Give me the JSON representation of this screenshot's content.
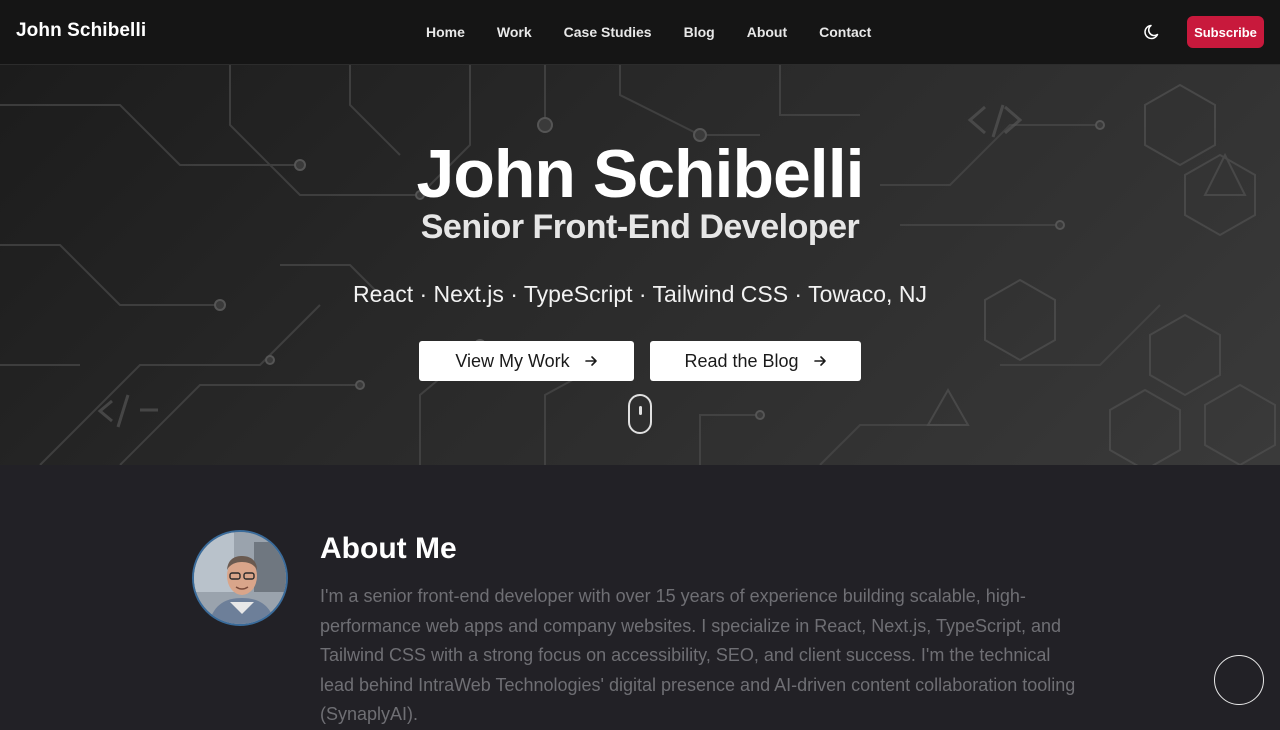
{
  "nav": {
    "brand": "John Schibelli",
    "links": [
      "Home",
      "Work",
      "Case Studies",
      "Blog",
      "About",
      "Contact"
    ],
    "theme_icon": "moon-icon",
    "subscribe_label": "Subscribe",
    "accent_color": "#c8193c"
  },
  "hero": {
    "title": "John Schibelli",
    "subtitle": "Senior Front-End Developer",
    "tech_line": "React · Next.js · TypeScript · Tailwind CSS · Towaco, NJ",
    "primary_button": "View My Work",
    "secondary_button": "Read the Blog",
    "button_icon": "arrow-right-icon",
    "scroll_icon": "mouse-scroll-icon"
  },
  "about": {
    "title": "About Me",
    "text": "I'm a senior front-end developer with over 15 years of experience building scalable, high-performance web apps and company websites. I specialize in React, Next.js, TypeScript, and Tailwind CSS with a strong focus on accessibility, SEO, and client success. I'm the technical lead behind IntraWeb Technologies' digital presence and AI-driven content collaboration tooling (SynaplyAI).",
    "avatar_icon": "profile-photo"
  },
  "floating": {
    "chat_icon": "circle-button-icon"
  }
}
